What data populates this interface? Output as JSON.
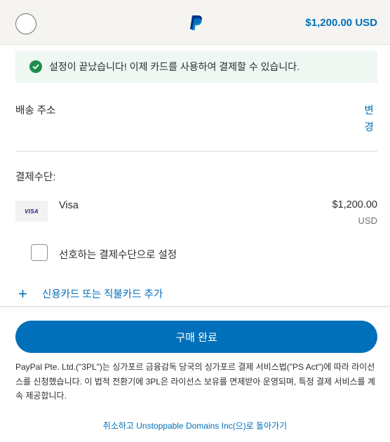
{
  "header": {
    "amount": "$1,200.00 USD"
  },
  "success": {
    "message": "설정이 끝났습니다! 이제 카드를 사용하여 결제할 수 있습니다."
  },
  "shipping": {
    "label": "배송 주소",
    "change_label": "변경"
  },
  "payment": {
    "label": "결제수단:",
    "card": {
      "brand_badge": "VISA",
      "name": "Visa",
      "amount": "$1,200.00",
      "currency": "USD"
    },
    "preferred_label": "선호하는 결제수단으로 설정",
    "preferred_checked": false,
    "add_card_label": "신용카드 또는 직불카드 추가"
  },
  "purchase": {
    "button_label": "구매 완료"
  },
  "legal": {
    "text": "PayPal Pte. Ltd.(\"3PL\")는 싱가포르 금융감독 당국의 싱가포르 결제 서비스법(\"PS Act\")에 따라 라이선스를 신청했습니다. 이 법적 전환기에 3PL은 라이선스 보유를 면제받아 운영되며, 특정 결제 서비스를 계속 제공합니다."
  },
  "cancel": {
    "label": "취소하고 Unstoppable Domains Inc(으)로 돌아가기"
  },
  "colors": {
    "brand_blue": "#0070ba",
    "success_green": "#1e8c4e",
    "success_bg": "#eef7f2"
  }
}
